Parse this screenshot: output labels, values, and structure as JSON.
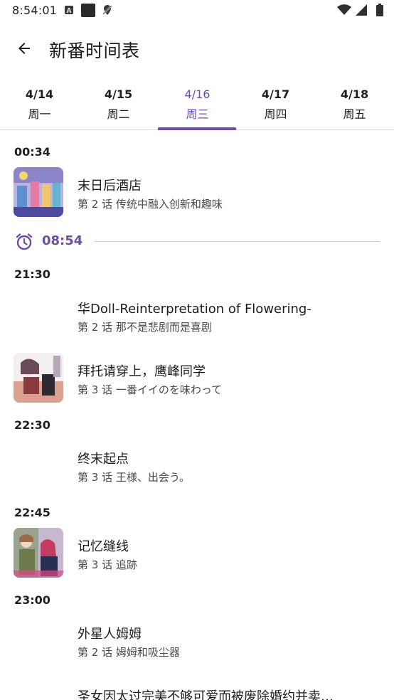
{
  "status_bar": {
    "time": "8:54:01",
    "icons": [
      "a-letter-icon",
      "app-square-icon",
      "no-location-icon",
      "wifi-icon",
      "signal-icon",
      "battery-icon"
    ]
  },
  "app_bar": {
    "back_icon": "arrow-left-icon",
    "title": "新番时间表"
  },
  "tabs": [
    {
      "date": "4/14",
      "day": "周一",
      "active": false
    },
    {
      "date": "4/15",
      "day": "周二",
      "active": false
    },
    {
      "date": "4/16",
      "day": "周三",
      "active": true
    },
    {
      "date": "4/17",
      "day": "周四",
      "active": false
    },
    {
      "date": "4/18",
      "day": "周五",
      "active": false
    }
  ],
  "accent_color": "#6b4fa3",
  "now_marker": {
    "icon": "alarm-clock-icon",
    "time": "08:54"
  },
  "schedule": [
    {
      "time": "00:34",
      "items": [
        {
          "title": "末日后酒店",
          "subtitle": "第 2 话  传统中融入创新和趣味",
          "has_thumb": true
        }
      ]
    },
    {
      "time": "21:30",
      "items": [
        {
          "title": "华Doll-Reinterpretation of Flowering-",
          "subtitle": "第 2 话  那不是悲剧而是喜剧",
          "has_thumb": false
        },
        {
          "title": "拜托请穿上，鹰峰同学",
          "subtitle": "第 3 话  一番イイのを味わって",
          "has_thumb": true
        }
      ]
    },
    {
      "time": "22:30",
      "items": [
        {
          "title": "终末起点",
          "subtitle": "第 3 话  王様、出会う。",
          "has_thumb": false
        }
      ]
    },
    {
      "time": "22:45",
      "items": [
        {
          "title": "记忆缝线",
          "subtitle": "第 3 话  追跡",
          "has_thumb": true
        }
      ]
    },
    {
      "time": "23:00",
      "items": [
        {
          "title": "外星人姆姆",
          "subtitle": "第 2 话  姆姆和吸尘器",
          "has_thumb": false
        },
        {
          "title": "圣女因太过完美不够可爱而被废除婚约并卖…",
          "subtitle": "",
          "has_thumb": false
        }
      ]
    }
  ]
}
